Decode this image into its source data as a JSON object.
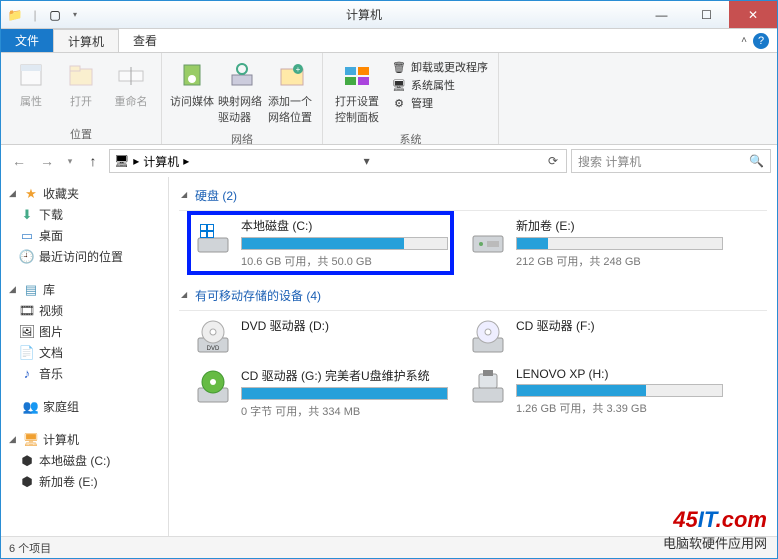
{
  "window": {
    "title": "计算机",
    "controls": {
      "min": "—",
      "max": "☐",
      "close": "✕"
    }
  },
  "tabs": {
    "file": "文件",
    "computer": "计算机",
    "view": "查看"
  },
  "ribbon": {
    "groups": {
      "location": {
        "label": "位置",
        "properties": "属性",
        "open": "打开",
        "rename": "重命名"
      },
      "network": {
        "label": "网络",
        "access_media": "访问媒体",
        "map_drive": "映射网络驱动器",
        "add_location": "添加一个网络位置"
      },
      "system": {
        "label": "系统",
        "open_settings": "打开设置",
        "control_panel": "控制面板",
        "uninstall": "卸载或更改程序",
        "sys_props": "系统属性",
        "manage": "管理"
      }
    }
  },
  "addressbar": {
    "path": "计算机",
    "sep": "▸",
    "search_placeholder": "搜索 计算机"
  },
  "sidebar": {
    "favorites": "收藏夹",
    "downloads": "下载",
    "desktop": "桌面",
    "recent": "最近访问的位置",
    "libraries": "库",
    "videos": "视频",
    "pictures": "图片",
    "documents": "文档",
    "music": "音乐",
    "homegroup": "家庭组",
    "computer": "计算机",
    "local_c": "本地磁盘 (C:)",
    "vol_e": "新加卷 (E:)"
  },
  "sections": {
    "hdd": "硬盘 (2)",
    "removable": "有可移动存储的设备 (4)"
  },
  "drives": [
    {
      "id": "c",
      "name": "本地磁盘 (C:)",
      "stats": "10.6 GB 可用，共 50.0 GB",
      "fill": 79,
      "bar": true,
      "icon": "hdd-win"
    },
    {
      "id": "e",
      "name": "新加卷 (E:)",
      "stats": "212 GB 可用，共 248 GB",
      "fill": 15,
      "bar": true,
      "icon": "hdd"
    },
    {
      "id": "d",
      "name": "DVD 驱动器 (D:)",
      "stats": "",
      "bar": false,
      "icon": "dvd"
    },
    {
      "id": "f",
      "name": "CD 驱动器 (F:)",
      "stats": "",
      "bar": false,
      "icon": "cd"
    },
    {
      "id": "g",
      "name": "CD 驱动器 (G:) 完美者U盘维护系统",
      "stats": "0 字节 可用，共 334 MB",
      "fill": 100,
      "bar": true,
      "icon": "cd-green"
    },
    {
      "id": "h",
      "name": "LENOVO XP (H:)",
      "stats": "1.26 GB 可用，共 3.39 GB",
      "fill": 63,
      "bar": true,
      "icon": "usb"
    }
  ],
  "statusbar": {
    "text": "6 个项目"
  },
  "watermark": {
    "logo_a": "45",
    "logo_b": "IT",
    "logo_c": ".com",
    "sub": "电脑软硬件应用网"
  }
}
